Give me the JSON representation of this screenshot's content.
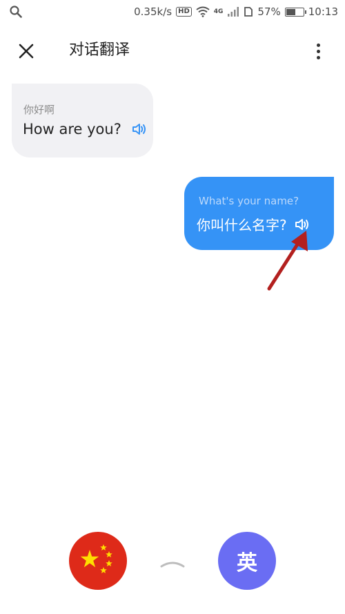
{
  "status_bar": {
    "speed": "0.35k/s",
    "hd": "HD",
    "network": "4G",
    "battery_percent": "57%",
    "battery_level": 0.57,
    "time": "10:13"
  },
  "app_bar": {
    "title": "对话翻译"
  },
  "messages": [
    {
      "side": "left",
      "original": "你好啊",
      "translation": "How are you?"
    },
    {
      "side": "right",
      "original": "What's your name?",
      "translation": "你叫什么名字?"
    }
  ],
  "languages": {
    "source_flag": "china-flag-icon",
    "target_label": "英"
  },
  "colors": {
    "accent_blue": "#3593f6",
    "bubble_gray": "#f1f1f4",
    "language_purple": "#6a6df3",
    "china_red": "#de2a19",
    "arrow_red": "#b3201f"
  }
}
